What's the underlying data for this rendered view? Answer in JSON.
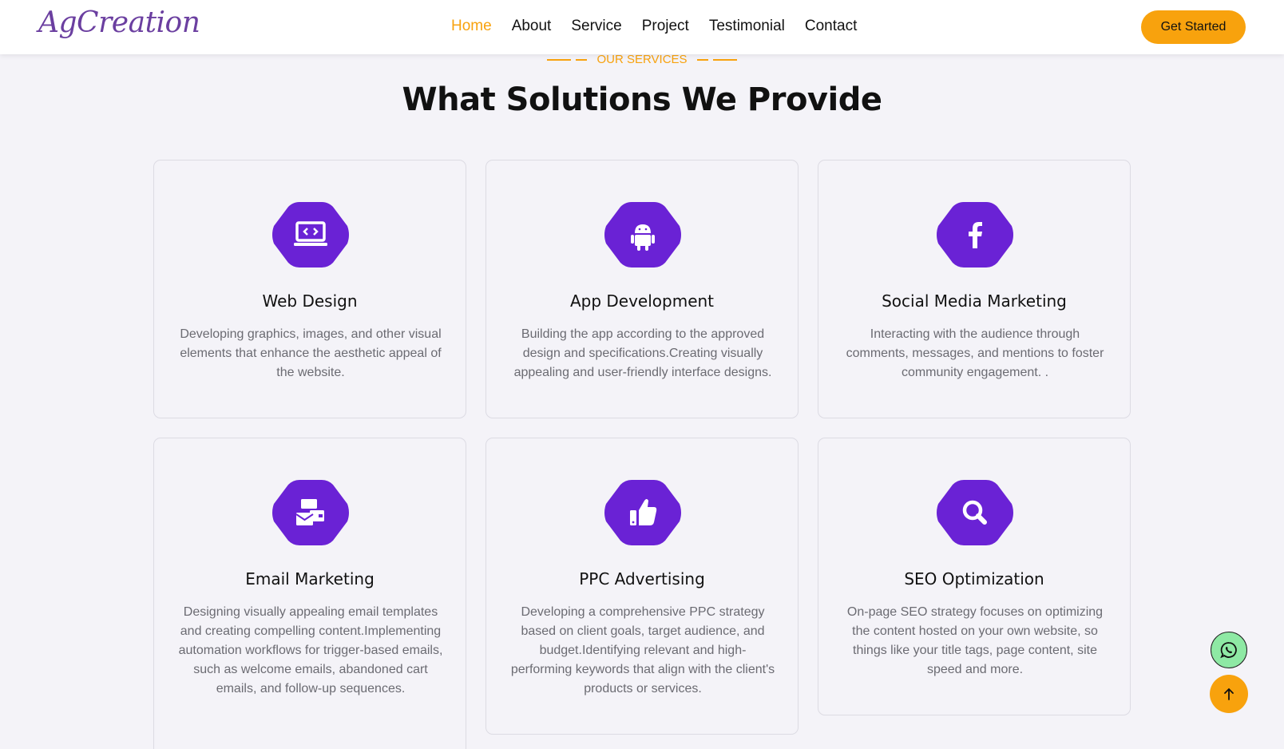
{
  "brand": {
    "logo": "AgCreation",
    "accent": "#f8a20d",
    "primary": "#6a22d5"
  },
  "nav": {
    "items": [
      {
        "label": "Home",
        "active": true
      },
      {
        "label": "About",
        "active": false
      },
      {
        "label": "Service",
        "active": false
      },
      {
        "label": "Project",
        "active": false
      },
      {
        "label": "Testimonial",
        "active": false
      },
      {
        "label": "Contact",
        "active": false
      }
    ],
    "cta": "Get Started"
  },
  "section": {
    "eyebrow": "OUR SERVICES",
    "title": "What Solutions We Provide"
  },
  "services": [
    {
      "icon": "laptop-code-icon",
      "title": "Web Design",
      "desc": "Developing graphics, images, and other visual elements that enhance the aesthetic appeal of the website."
    },
    {
      "icon": "android-icon",
      "title": "App Development",
      "desc": "Building the app according to the approved design and specifications.Creating visually appealing and user-friendly interface designs."
    },
    {
      "icon": "facebook-icon",
      "title": "Social Media Marketing",
      "desc": "Interacting with the audience through comments, messages, and mentions to foster community engagement. ."
    },
    {
      "icon": "mail-bulk-icon",
      "title": "Email Marketing",
      "desc": "Designing visually appealing email templates and creating compelling content.Implementing automation workflows for trigger-based emails, such as welcome emails, abandoned cart emails, and follow-up sequences."
    },
    {
      "icon": "thumbs-up-icon",
      "title": "PPC Advertising",
      "desc": "Developing a comprehensive PPC strategy based on client goals, target audience, and budget.Identifying relevant and high-performing keywords that align with the client's products or services."
    },
    {
      "icon": "search-icon",
      "title": "SEO Optimization",
      "desc": "On-page SEO strategy focuses on optimizing the content hosted on your own website, so things like your title tags, page content, site speed and more."
    }
  ],
  "floating": {
    "whatsapp_icon": "whatsapp-icon",
    "top_icon": "arrow-up-icon"
  }
}
